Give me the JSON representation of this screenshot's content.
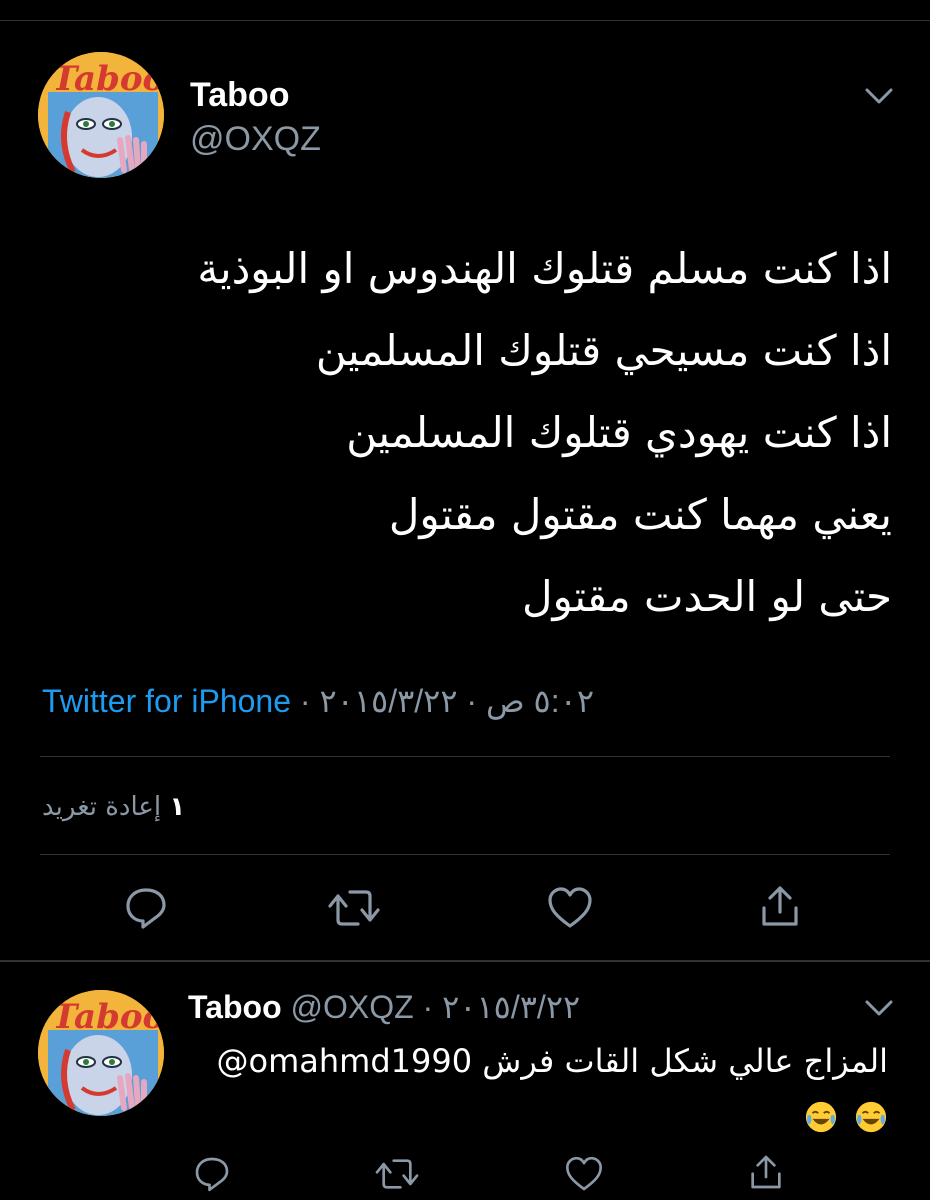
{
  "tweet": {
    "author_name": "Taboo",
    "author_handle": "@OXQZ",
    "avatar_text": "Taboo",
    "lines": [
      "اذا كنت مسلم قتلوك الهندوس او البوذية",
      "اذا كنت مسيحي قتلوك المسلمين",
      "اذا كنت يهودي قتلوك المسلمين",
      "يعني مهما كنت مقتول مقتول",
      "حتى لو الحدت مقتول"
    ],
    "source": "Twitter for iPhone",
    "separator": " · ",
    "date": "٢٠١٥/٣/٢٢",
    "time": "٥:٠٢ ص",
    "retweet_count": "١",
    "retweet_label": "إعادة تغريد"
  },
  "reply": {
    "author_name": "Taboo",
    "author_handle": "@OXQZ",
    "separator": " · ",
    "date": "٢٠١٥/٣/٢٢",
    "mention": "@omahmd1990",
    "text": "المزاج عالي شكل القات فرش",
    "emoji": [
      "face-with-tears-of-joy",
      "face-with-tears-of-joy"
    ]
  },
  "icons": {
    "reply": "reply-icon",
    "retweet": "retweet-icon",
    "like": "heart-icon",
    "share": "share-icon",
    "more": "chevron-down-icon"
  },
  "colors": {
    "background": "#000000",
    "text": "#ffffff",
    "muted": "#8b98a5",
    "link": "#1d9bf0",
    "divider": "#2f3336"
  }
}
